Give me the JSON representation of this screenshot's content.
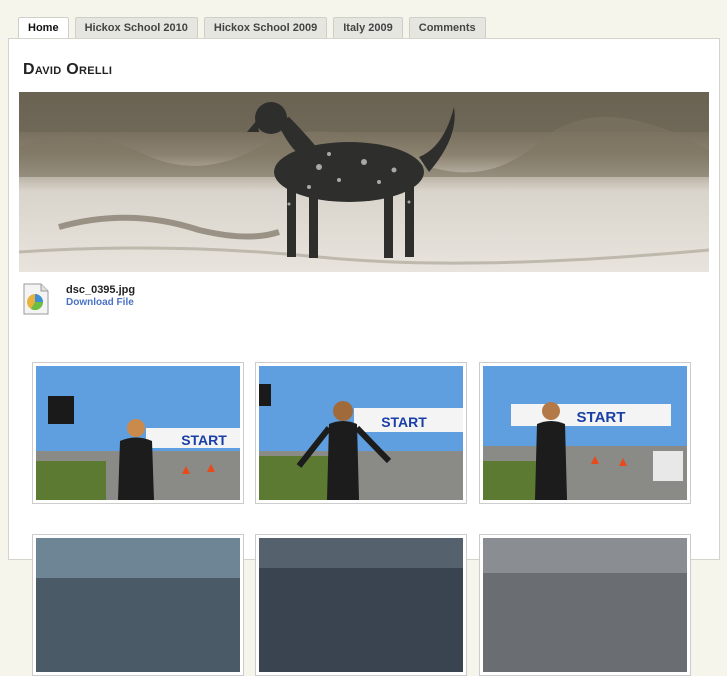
{
  "tabs": [
    {
      "label": "Home",
      "active": true
    },
    {
      "label": "Hickox School 2010"
    },
    {
      "label": "Hickox School 2009"
    },
    {
      "label": "Italy 2009"
    },
    {
      "label": "Comments"
    }
  ],
  "page": {
    "title": "David Orelli"
  },
  "attachment": {
    "icon": "image-file-icon",
    "filename": "dsc_0395.jpg",
    "download_label": "Download File"
  },
  "gallery": {
    "banner_text": "START",
    "photos": [
      {
        "alt": "photo-1"
      },
      {
        "alt": "photo-2"
      },
      {
        "alt": "photo-3"
      },
      {
        "alt": "photo-4"
      },
      {
        "alt": "photo-5"
      },
      {
        "alt": "photo-6"
      }
    ]
  },
  "colors": {
    "link": "#4a72c4",
    "sky": "#5f9fe0",
    "start_banner": "#1a3fa6"
  }
}
